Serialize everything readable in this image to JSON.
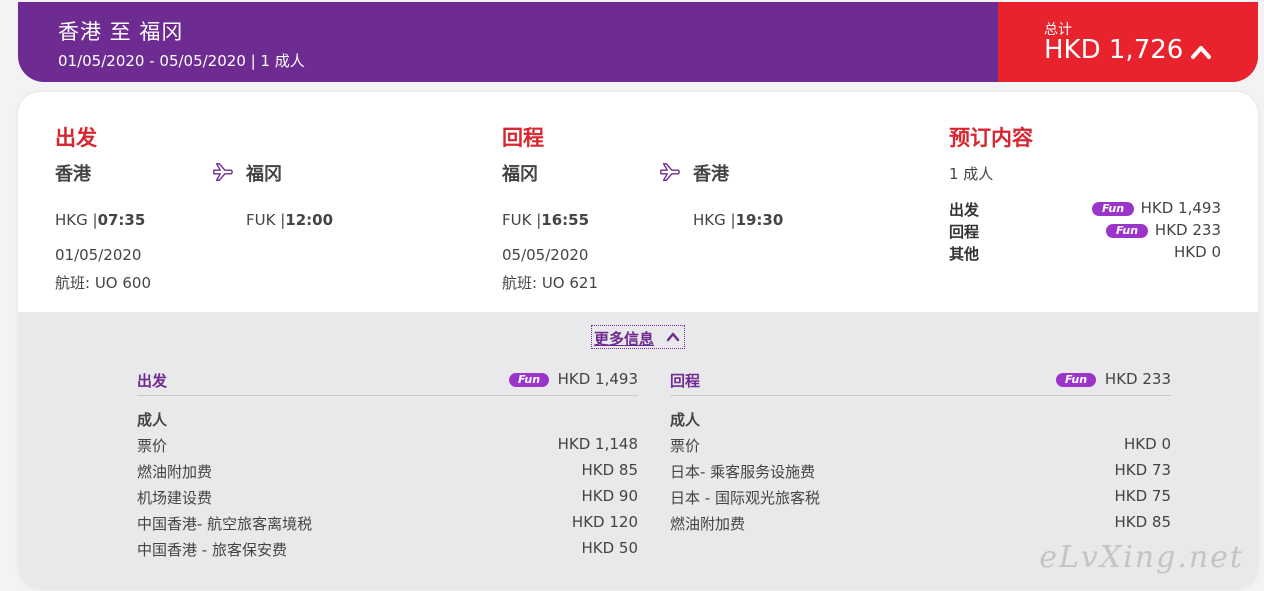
{
  "header": {
    "route": "香港 至 福冈",
    "subtitle": "01/05/2020 - 05/05/2020 | 1 成人",
    "total_label": "总计",
    "total_amount": "HKD 1,726",
    "accent_purple": "#6e2b91",
    "accent_red": "#e8232d"
  },
  "outbound": {
    "heading": "出发",
    "from_city": "香港",
    "to_city": "福冈",
    "from_code": "HKG |",
    "from_time": "07:35",
    "to_code": "FUK |",
    "to_time": "12:00",
    "date": "01/05/2020",
    "flight": "航班: UO 600"
  },
  "return": {
    "heading": "回程",
    "from_city": "福冈",
    "to_city": "香港",
    "from_code": "FUK |",
    "from_time": "16:55",
    "to_code": "HKG |",
    "to_time": "19:30",
    "date": "05/05/2020",
    "flight": "航班: UO 621"
  },
  "summary": {
    "heading": "预订内容",
    "pax": "1 成人",
    "rows": [
      {
        "label": "出发",
        "badge": "Fun",
        "amount": "HKD 1,493"
      },
      {
        "label": "回程",
        "badge": "Fun",
        "amount": "HKD 233"
      },
      {
        "label": "其他",
        "amount": "HKD 0"
      }
    ]
  },
  "more_info": {
    "toggle_label": "更多信息",
    "left": {
      "title": "出发",
      "badge": "Fun",
      "amount": "HKD 1,493",
      "pax_label": "成人",
      "rows": [
        {
          "name": "票价",
          "value": "HKD 1,148"
        },
        {
          "name": "燃油附加费",
          "value": "HKD 85"
        },
        {
          "name": "机场建设费",
          "value": "HKD 90"
        },
        {
          "name": "中国香港- 航空旅客离境税",
          "value": "HKD 120"
        },
        {
          "name": "中国香港 - 旅客保安费",
          "value": "HKD 50"
        }
      ]
    },
    "right": {
      "title": "回程",
      "badge": "Fun",
      "amount": "HKD 233",
      "pax_label": "成人",
      "rows": [
        {
          "name": "票价",
          "value": "HKD 0"
        },
        {
          "name": "日本- 乘客服务设施费",
          "value": "HKD 73"
        },
        {
          "name": "日本 - 国际观光旅客税",
          "value": "HKD 75"
        },
        {
          "name": "燃油附加费",
          "value": "HKD 85"
        }
      ]
    }
  },
  "watermark": "eLvXing.net"
}
